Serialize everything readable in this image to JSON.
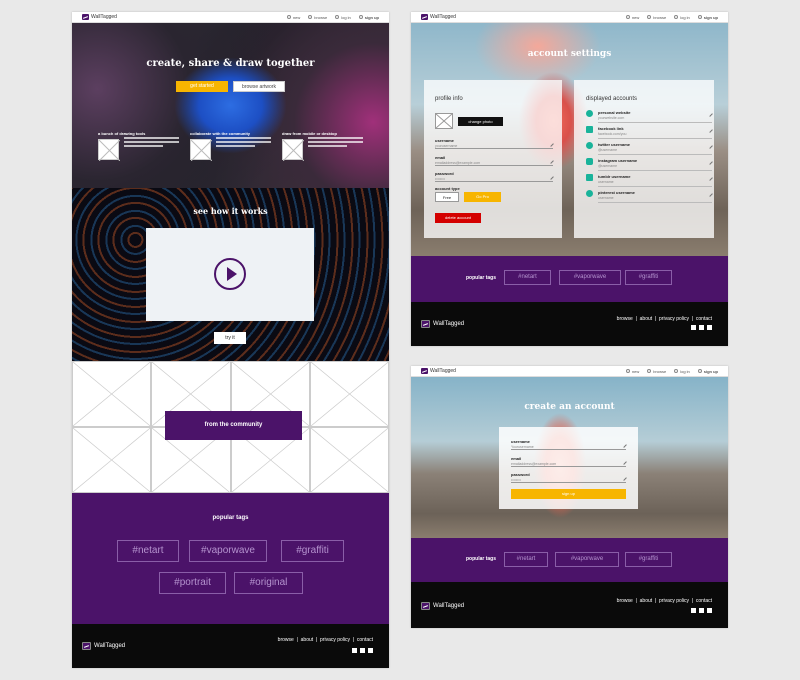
{
  "nav": {
    "brand": "WallTagged",
    "links": [
      "new",
      "browse",
      "log in",
      "sign up"
    ]
  },
  "home": {
    "hero_title": "create, share & draw together",
    "get_started": "get started",
    "browse_artwork": "browse artwork",
    "features": [
      {
        "title": "a bunch of drawing tools"
      },
      {
        "title": "collaborate with the community"
      },
      {
        "title": "draw from mobile or desktop"
      }
    ],
    "how_title": "see how it works",
    "try_it": "try it",
    "community_label": "from the community",
    "popular_tags_heading": "popular tags",
    "tags": [
      "#netart",
      "#vaporwave",
      "#graffiti",
      "#portrait",
      "#original"
    ]
  },
  "footer": {
    "brand": "WallTagged",
    "links": "browse  |  about  |  privacy policy  |  contact"
  },
  "account_settings": {
    "title": "account settings",
    "profile_heading": "profile info",
    "change_photo": "change photo",
    "fields": [
      {
        "label": "username",
        "value": "yourusername"
      },
      {
        "label": "email",
        "value": "emailaddress@example.com"
      },
      {
        "label": "password",
        "value": "••••••••"
      }
    ],
    "account_type_label": "account type",
    "type_free": "Free",
    "type_pro": "Go Pro",
    "delete_account": "delete account",
    "displayed_heading": "displayed accounts",
    "accounts": [
      {
        "label": "personal website",
        "value": "yourwebsite.com"
      },
      {
        "label": "facebook link",
        "value": "facebook.com/you"
      },
      {
        "label": "twitter username",
        "value": "@username"
      },
      {
        "label": "instagram username",
        "value": "@username"
      },
      {
        "label": "tumblr username",
        "value": "username"
      },
      {
        "label": "pinterest username",
        "value": "username"
      }
    ],
    "popular_tags_heading": "popular tags",
    "tags": [
      "#netart",
      "#vaporwave",
      "#graffiti"
    ]
  },
  "create_account": {
    "title": "create an account",
    "fields": [
      {
        "label": "username",
        "value": "Yourusername"
      },
      {
        "label": "email",
        "value": "emailaddress@example.com"
      },
      {
        "label": "password",
        "value": "••••••••"
      }
    ],
    "sign_up": "sign up",
    "popular_tags_heading": "popular tags",
    "tags": [
      "#netart",
      "#vaporwave",
      "#graffiti"
    ]
  },
  "colors": {
    "purple": "#4b1369",
    "yellow": "#f7b500",
    "red": "#d40000",
    "teal": "#19b39a"
  }
}
